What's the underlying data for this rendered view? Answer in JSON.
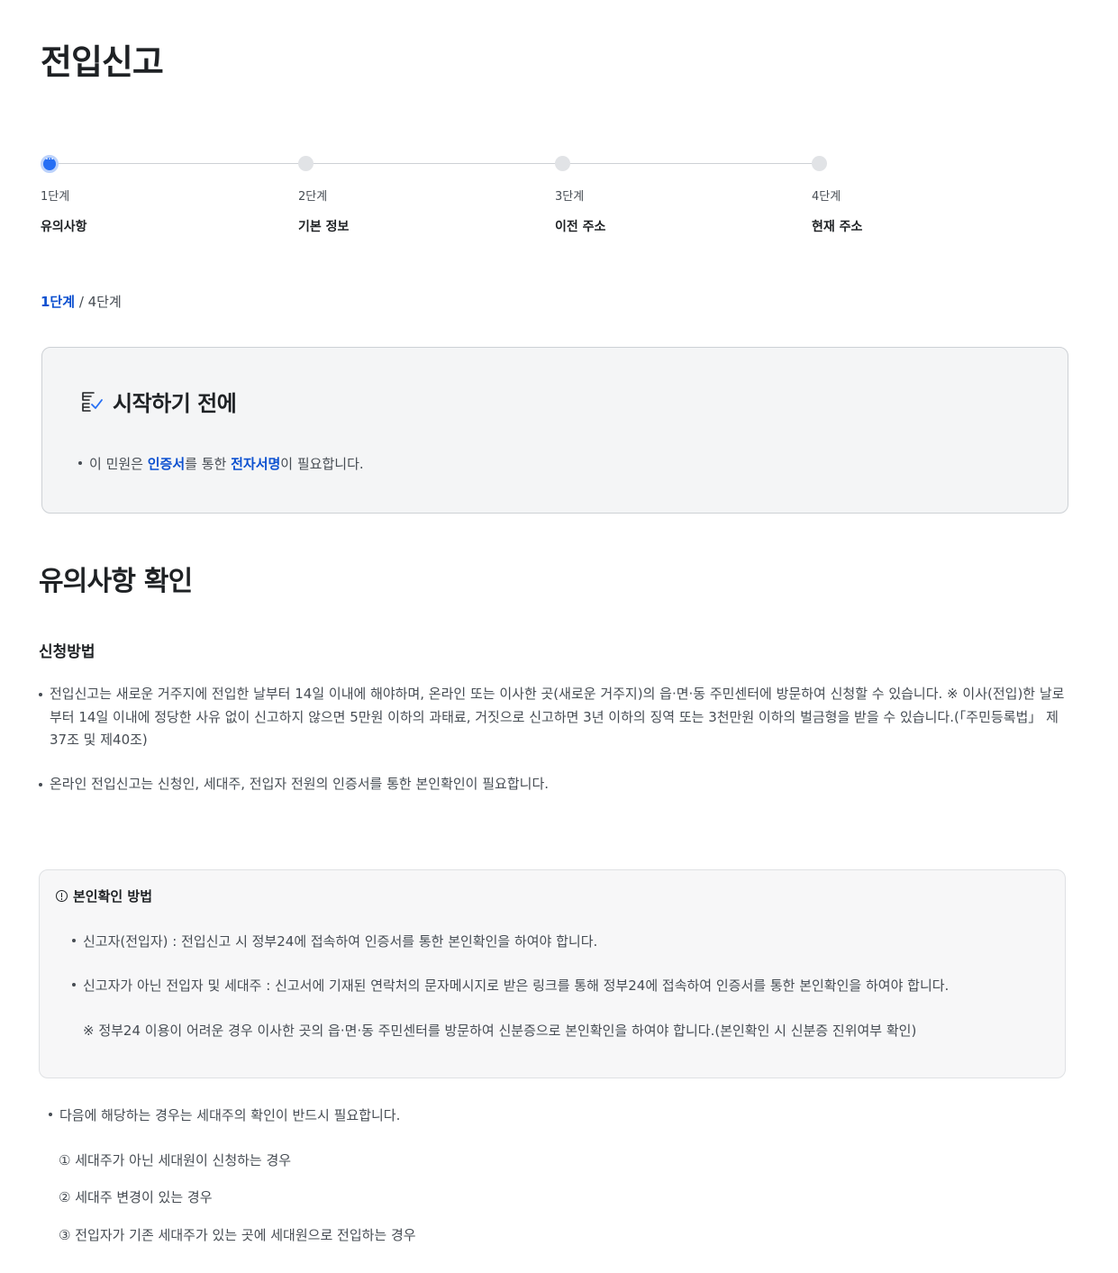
{
  "page_title": "전입신고",
  "stepper": {
    "steps": [
      {
        "num": "1단계",
        "name": "유의사항",
        "active": true
      },
      {
        "num": "2단계",
        "name": "기본 정보",
        "active": false
      },
      {
        "num": "3단계",
        "name": "이전 주소",
        "active": false
      },
      {
        "num": "4단계",
        "name": "현재 주소",
        "active": false
      }
    ]
  },
  "progress": {
    "current": "1단계",
    "separator": " / ",
    "total": "4단계"
  },
  "before_start": {
    "icon": "checklist-icon",
    "title": "시작하기 전에",
    "item_parts": [
      "이 민원은 ",
      "인증서",
      "를 통한 ",
      "전자서명",
      "이 필요합니다."
    ]
  },
  "notice": {
    "title": "유의사항 확인",
    "method_title": "신청방법",
    "paragraphs": [
      "전입신고는 새로운 거주지에 전입한 날부터 14일 이내에 해야하며, 온라인 또는 이사한 곳(새로운 거주지)의 읍·면·동 주민센터에 방문하여 신청할 수 있습니다. ※ 이사(전입)한 날로부터 14일 이내에 정당한 사유 없이 신고하지 않으면 5만원 이하의 과태료, 거짓으로 신고하면 3년 이하의 징역 또는 3천만원 이하의 벌금형을 받을 수 있습니다.(「주민등록법」 제37조 및 제40조)",
      "온라인 전입신고는 신청인, 세대주, 전입자 전원의 인증서를 통한 본인확인이 필요합니다."
    ]
  },
  "identity": {
    "icon": "info-circle-icon",
    "title": "본인확인 방법",
    "items": [
      "신고자(전입자) : 전입신고 시 정부24에 접속하여 인증서를 통한 본인확인을 하여야 합니다.",
      "신고자가 아닌 전입자 및 세대주 : 신고서에 기재된 연락처의 문자메시지로 받은 링크를 통해 정부24에 접속하여 인증서를 통한 본인확인을 하여야 합니다."
    ],
    "note": "※ 정부24 이용이 어려운 경우 이사한 곳의 읍·면·동 주민센터를 방문하여 신분증으로 본인확인을 하여야 합니다.(본인확인 시 신분증 진위여부 확인)"
  },
  "cases": {
    "lead": "다음에 해당하는 경우는 세대주의 확인이 반드시 필요합니다.",
    "items": [
      "① 세대주가 아닌 세대원이 신청하는 경우",
      "② 세대주 변경이 있는 경우",
      "③ 전입자가 기존 세대주가 있는 곳에 세대원으로 전입하는 경우"
    ]
  },
  "colors": {
    "accent": "#256ef4",
    "link": "#0b50d0",
    "text": "#1e2124",
    "subtext": "#464c53"
  }
}
